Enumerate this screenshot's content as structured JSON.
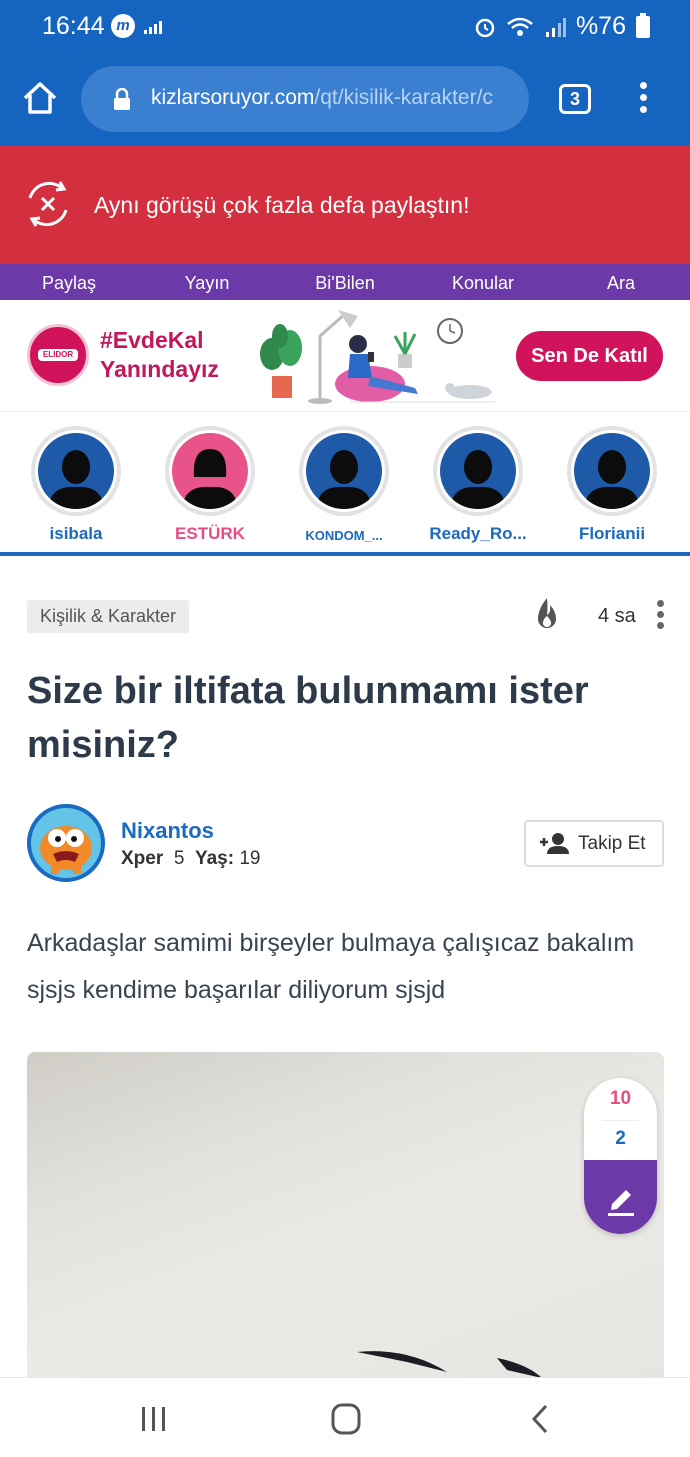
{
  "status_bar": {
    "time": "16:44",
    "battery": "%76",
    "icons": [
      "messenger-icon",
      "data-bars-icon",
      "alarm-icon",
      "wifi-icon",
      "signal-icon",
      "battery-icon"
    ]
  },
  "browser": {
    "url_domain": "kizlarsoruyor.com",
    "url_path": "/qt/kisilik-karakter/c",
    "tab_count": "3"
  },
  "error_banner": {
    "message": "Aynı görüşü çok fazla defa paylaştın!"
  },
  "nav": {
    "items": [
      {
        "label": "Paylaş"
      },
      {
        "label": "Yayın"
      },
      {
        "label": "Bi'Bilen"
      },
      {
        "label": "Konular"
      },
      {
        "label": "Ara"
      }
    ]
  },
  "ad": {
    "brand": "ELIDOR",
    "hashtag_line1": "#EvdeKal",
    "hashtag_line2": "Yanındayız",
    "cta": "Sen De Katıl"
  },
  "stories": [
    {
      "name": "isibala",
      "gender": "male"
    },
    {
      "name": "ESTÜRK",
      "gender": "female"
    },
    {
      "name": "KONDOM_...",
      "gender": "male"
    },
    {
      "name": "Ready_Ro...",
      "gender": "male"
    },
    {
      "name": "Florianii",
      "gender": "male"
    }
  ],
  "post": {
    "category": "Kişilik & Karakter",
    "time_ago": "4 sa",
    "title": "Size bir iltifata bulunmamı ister misiniz?",
    "author": {
      "name": "Nixantos",
      "level_label": "Xper",
      "level": "5",
      "age_label": "Yaş:",
      "age": "19"
    },
    "follow_label": "Takip Et",
    "body": "Arkadaşlar samimi birşeyler bulmaya çalışıcaz bakalım sjsjs kendime başarılar diliyorum sjsjd",
    "stats": {
      "top": "10",
      "middle": "2"
    }
  },
  "colors": {
    "primary_blue": "#1565c0",
    "error_red": "#d32f3f",
    "nav_purple": "#6b3aa8",
    "brand_pink": "#d1135b"
  }
}
